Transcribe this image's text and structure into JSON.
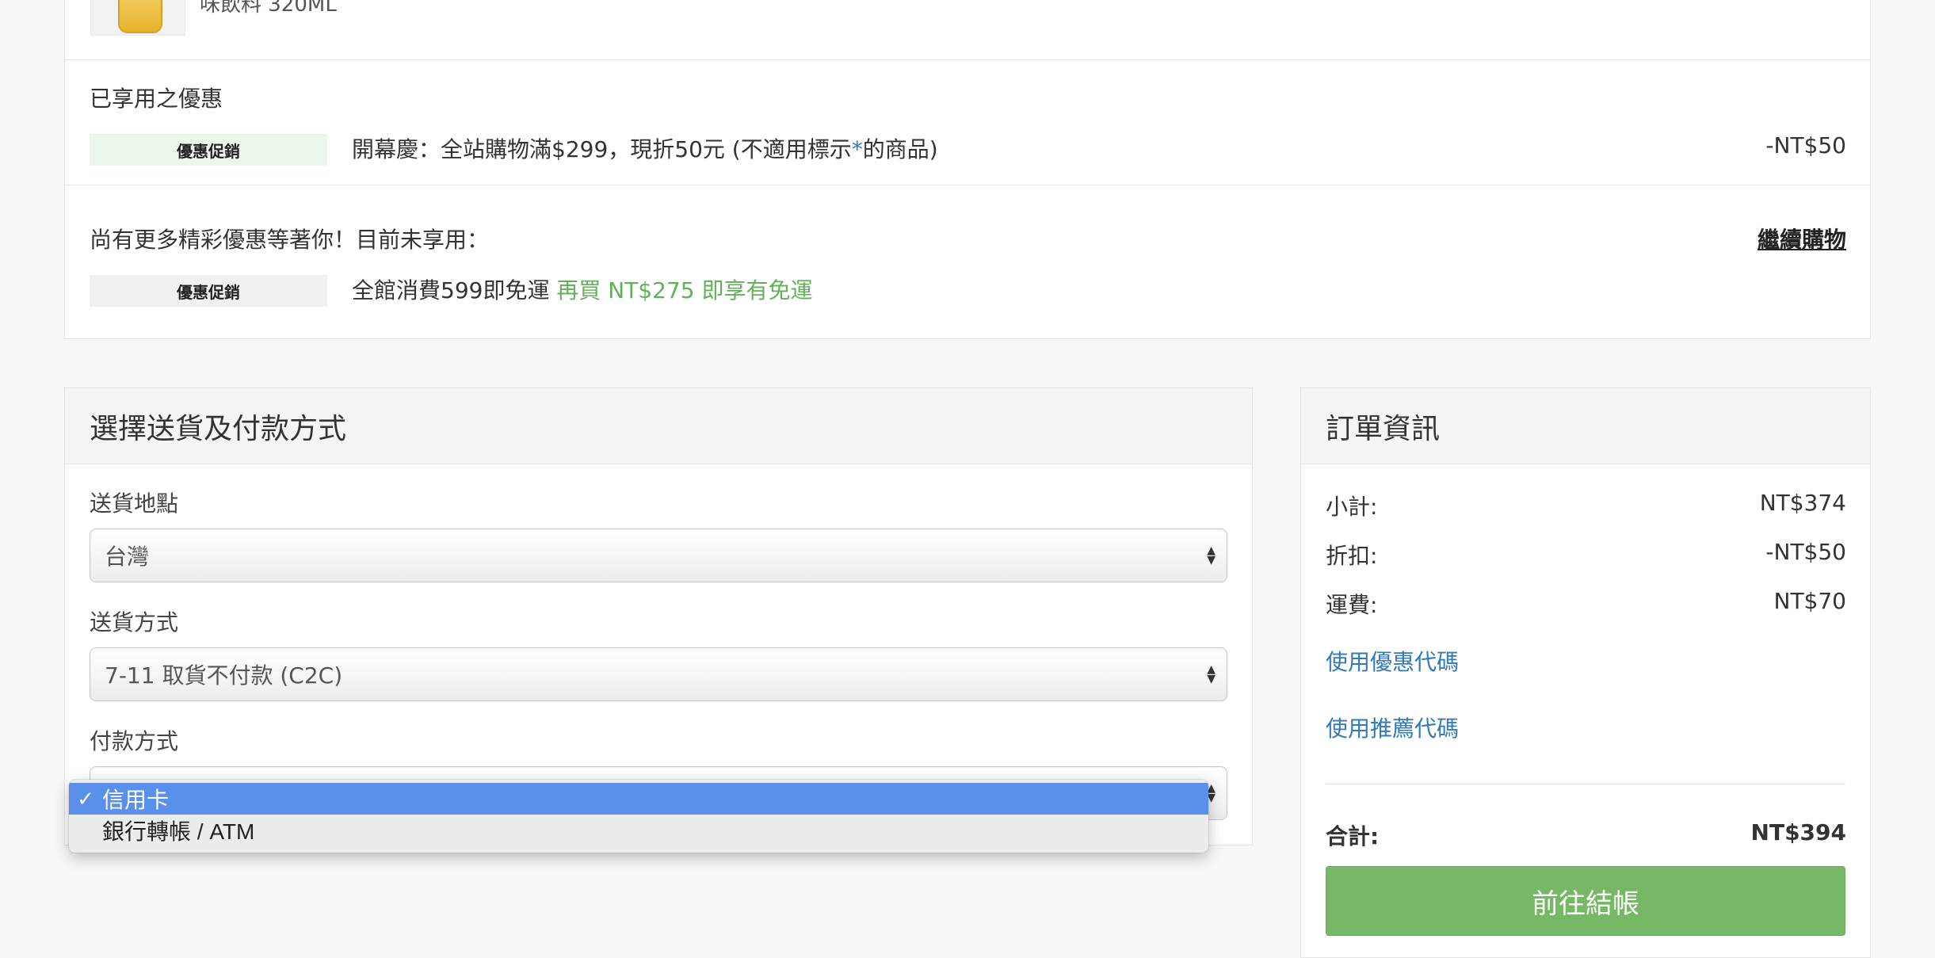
{
  "cart": {
    "product_name": "味飲料 320ML"
  },
  "applied": {
    "title": "已享用之優惠",
    "badge": "優惠促銷",
    "text_before": "開幕慶：全站購物滿$299，現折50元 (不適用標示",
    "star": "*",
    "text_after": "的商品)",
    "amount": "-NT$50"
  },
  "more": {
    "title": "尚有更多精彩優惠等著你！目前未享用：",
    "continue_link": "繼續購物",
    "badge": "優惠促銷",
    "text": "全館消費599即免運",
    "highlight": "再買 NT$275 即享有免運"
  },
  "shipping": {
    "header": "選擇送貨及付款方式",
    "location_label": "送貨地點",
    "location_value": "台灣",
    "method_label": "送貨方式",
    "method_value": "7-11 取貨不付款 (C2C)",
    "payment_label": "付款方式",
    "payment_options": [
      "信用卡",
      "銀行轉帳 / ATM"
    ],
    "selected_mark": "✓"
  },
  "summary": {
    "header": "訂單資訊",
    "subtotal_label": "小計:",
    "subtotal_value": "NT$374",
    "discount_label": "折扣:",
    "discount_value": "-NT$50",
    "shipping_label": "運費:",
    "shipping_value": "NT$70",
    "coupon_link": "使用優惠代碼",
    "referral_link": "使用推薦代碼",
    "total_label": "合計:",
    "total_value": "NT$394",
    "checkout_button": "前往結帳"
  },
  "colors": {
    "badge_applied_bg": "#eaf7ea",
    "badge_more_bg": "#f1f1f1",
    "highlight_green": "#62b15a",
    "link_blue": "#337ab7",
    "button_green": "#77b866",
    "dropdown_selected": "#5a8fea"
  }
}
